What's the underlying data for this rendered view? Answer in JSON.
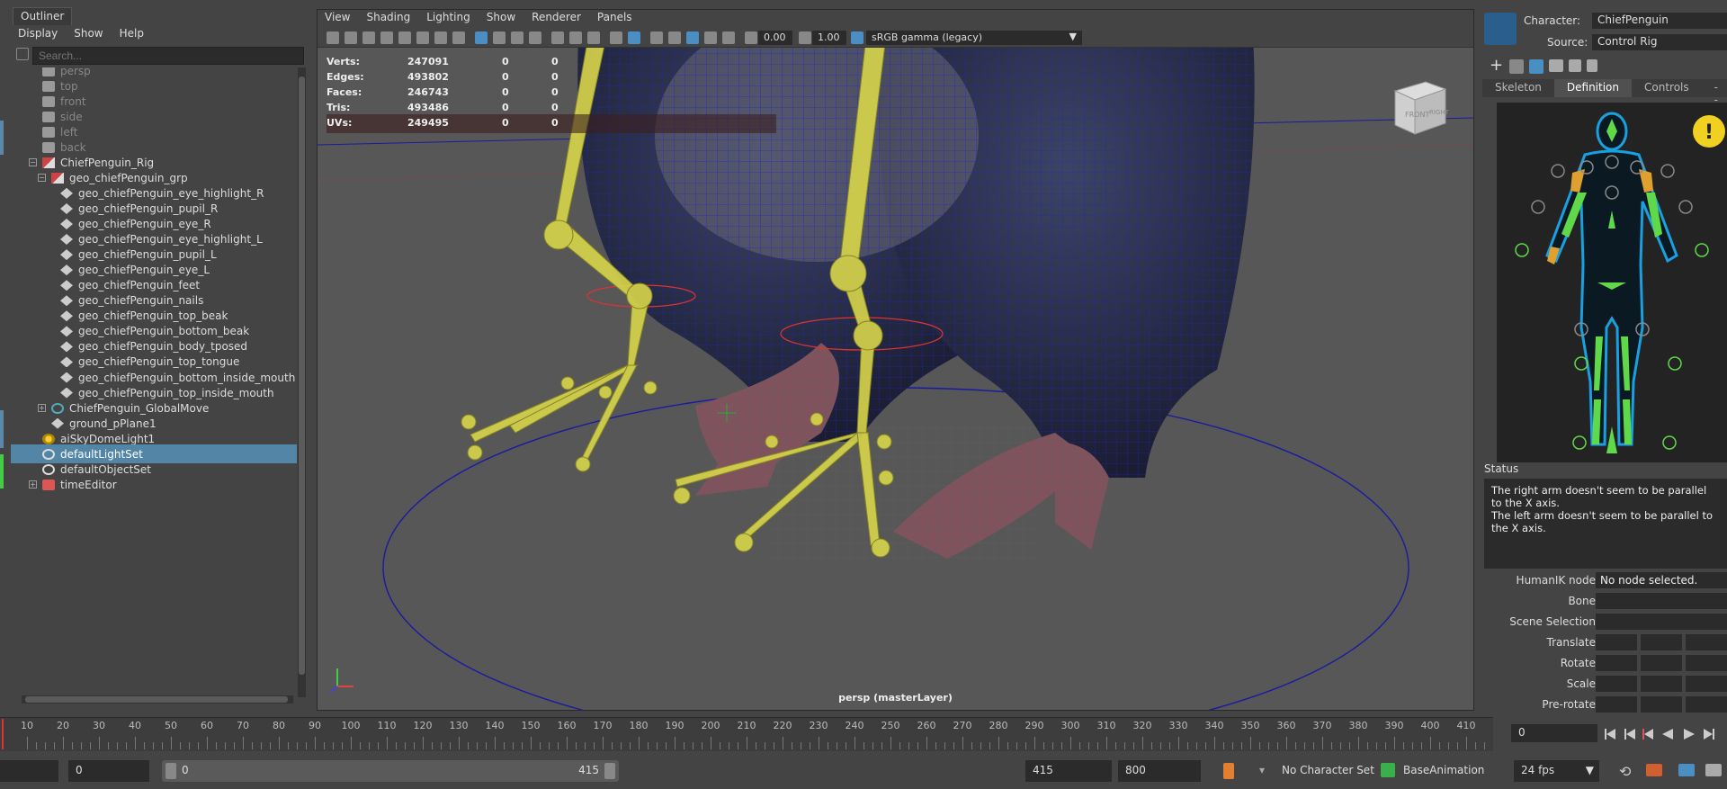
{
  "outliner": {
    "tab": "Outliner",
    "menu": [
      "Display",
      "Show",
      "Help"
    ],
    "search_placeholder": "Search...",
    "items": [
      {
        "label": "persp",
        "icon": "camera-icon",
        "indent": 1,
        "dim": true
      },
      {
        "label": "top",
        "icon": "camera-icon",
        "indent": 1,
        "dim": true
      },
      {
        "label": "front",
        "icon": "camera-icon",
        "indent": 1,
        "dim": true
      },
      {
        "label": "side",
        "icon": "camera-icon",
        "indent": 1,
        "dim": true
      },
      {
        "label": "left",
        "icon": "camera-icon",
        "indent": 1,
        "dim": true
      },
      {
        "label": "back",
        "icon": "camera-icon",
        "indent": 1,
        "dim": true
      },
      {
        "label": "ChiefPenguin_Rig",
        "icon": "rig-icon",
        "indent": 1,
        "expander": "−"
      },
      {
        "label": "geo_chiefPenguin_grp",
        "icon": "rig-icon",
        "indent": 2,
        "expander": "−"
      },
      {
        "label": "geo_chiefPenguin_eye_highlight_R",
        "icon": "mesh-icon",
        "indent": 3
      },
      {
        "label": "geo_chiefPenguin_pupil_R",
        "icon": "mesh-icon",
        "indent": 3
      },
      {
        "label": "geo_chiefPenguin_eye_R",
        "icon": "mesh-icon",
        "indent": 3
      },
      {
        "label": "geo_chiefPenguin_eye_highlight_L",
        "icon": "mesh-icon",
        "indent": 3
      },
      {
        "label": "geo_chiefPenguin_pupil_L",
        "icon": "mesh-icon",
        "indent": 3
      },
      {
        "label": "geo_chiefPenguin_eye_L",
        "icon": "mesh-icon",
        "indent": 3
      },
      {
        "label": "geo_chiefPenguin_feet",
        "icon": "mesh-icon",
        "indent": 3
      },
      {
        "label": "geo_chiefPenguin_nails",
        "icon": "mesh-icon",
        "indent": 3
      },
      {
        "label": "geo_chiefPenguin_top_beak",
        "icon": "mesh-icon",
        "indent": 3
      },
      {
        "label": "geo_chiefPenguin_bottom_beak",
        "icon": "mesh-icon",
        "indent": 3
      },
      {
        "label": "geo_chiefPenguin_body_tposed",
        "icon": "mesh-icon",
        "indent": 3
      },
      {
        "label": "geo_chiefPenguin_top_tongue",
        "icon": "mesh-icon",
        "indent": 3
      },
      {
        "label": "geo_chiefPenguin_bottom_inside_mouth",
        "icon": "mesh-icon",
        "indent": 3
      },
      {
        "label": "geo_chiefPenguin_top_inside_mouth",
        "icon": "mesh-icon",
        "indent": 3
      },
      {
        "label": "ChiefPenguin_GlobalMove",
        "icon": "curve-icon",
        "indent": 2,
        "expander": "+"
      },
      {
        "label": "ground_pPlane1",
        "icon": "mesh-icon",
        "indent": 2
      },
      {
        "label": "aiSkyDomeLight1",
        "icon": "light-icon",
        "indent": 1
      },
      {
        "label": "defaultLightSet",
        "icon": "set-icon",
        "indent": 1,
        "selected": true
      },
      {
        "label": "defaultObjectSet",
        "icon": "set-icon",
        "indent": 1
      },
      {
        "label": "timeEditor",
        "icon": "clock-icon",
        "indent": 1,
        "expander": "+"
      }
    ]
  },
  "viewport": {
    "menu": [
      "View",
      "Shading",
      "Lighting",
      "Show",
      "Renderer",
      "Panels"
    ],
    "exposure": "0.00",
    "gamma": "1.00",
    "color_space": "sRGB gamma (legacy)",
    "hud": [
      {
        "label": "Verts:",
        "v1": "247091",
        "v2": "0",
        "v3": "0"
      },
      {
        "label": "Edges:",
        "v1": "493802",
        "v2": "0",
        "v3": "0"
      },
      {
        "label": "Faces:",
        "v1": "246743",
        "v2": "0",
        "v3": "0"
      },
      {
        "label": "Tris:",
        "v1": "493486",
        "v2": "0",
        "v3": "0"
      },
      {
        "label": "UVs:",
        "v1": "249495",
        "v2": "0",
        "v3": "0"
      }
    ],
    "camera_label": "persp (masterLayer)",
    "viewcube_front": "FRONT",
    "viewcube_right": "RIGHT"
  },
  "humanik": {
    "character_label": "Character:",
    "character_value": "ChiefPenguin",
    "source_label": "Source:",
    "source_value": "Control Rig",
    "tabs": [
      "Skeleton",
      "Definition",
      "Controls",
      "---"
    ],
    "active_tab": "Definition",
    "status_title": "Status",
    "status_lines": [
      "The right arm doesn't seem to be parallel to the X axis.",
      "The left arm doesn't seem to be parallel to the X axis."
    ],
    "node_label": "HumanIK node",
    "node_value": "No node selected.",
    "props": [
      "Bone",
      "Scene Selection",
      "Translate",
      "Rotate",
      "Scale",
      "Pre-rotate"
    ]
  },
  "timeline": {
    "ticks": [
      10,
      20,
      30,
      40,
      50,
      60,
      70,
      80,
      90,
      100,
      110,
      120,
      130,
      140,
      150,
      160,
      170,
      180,
      190,
      200,
      210,
      220,
      230,
      240,
      250,
      260,
      270,
      280,
      290,
      300,
      310,
      320,
      330,
      340,
      350,
      360,
      370,
      380,
      390,
      400,
      410
    ],
    "current_frame": "0"
  },
  "range": {
    "start_outer": "0",
    "slider_start": "0",
    "slider_end": "415",
    "end_field": "415",
    "end_outer": "800",
    "character_set": "No Character Set",
    "anim_layer": "BaseAnimation",
    "fps": "24 fps"
  }
}
